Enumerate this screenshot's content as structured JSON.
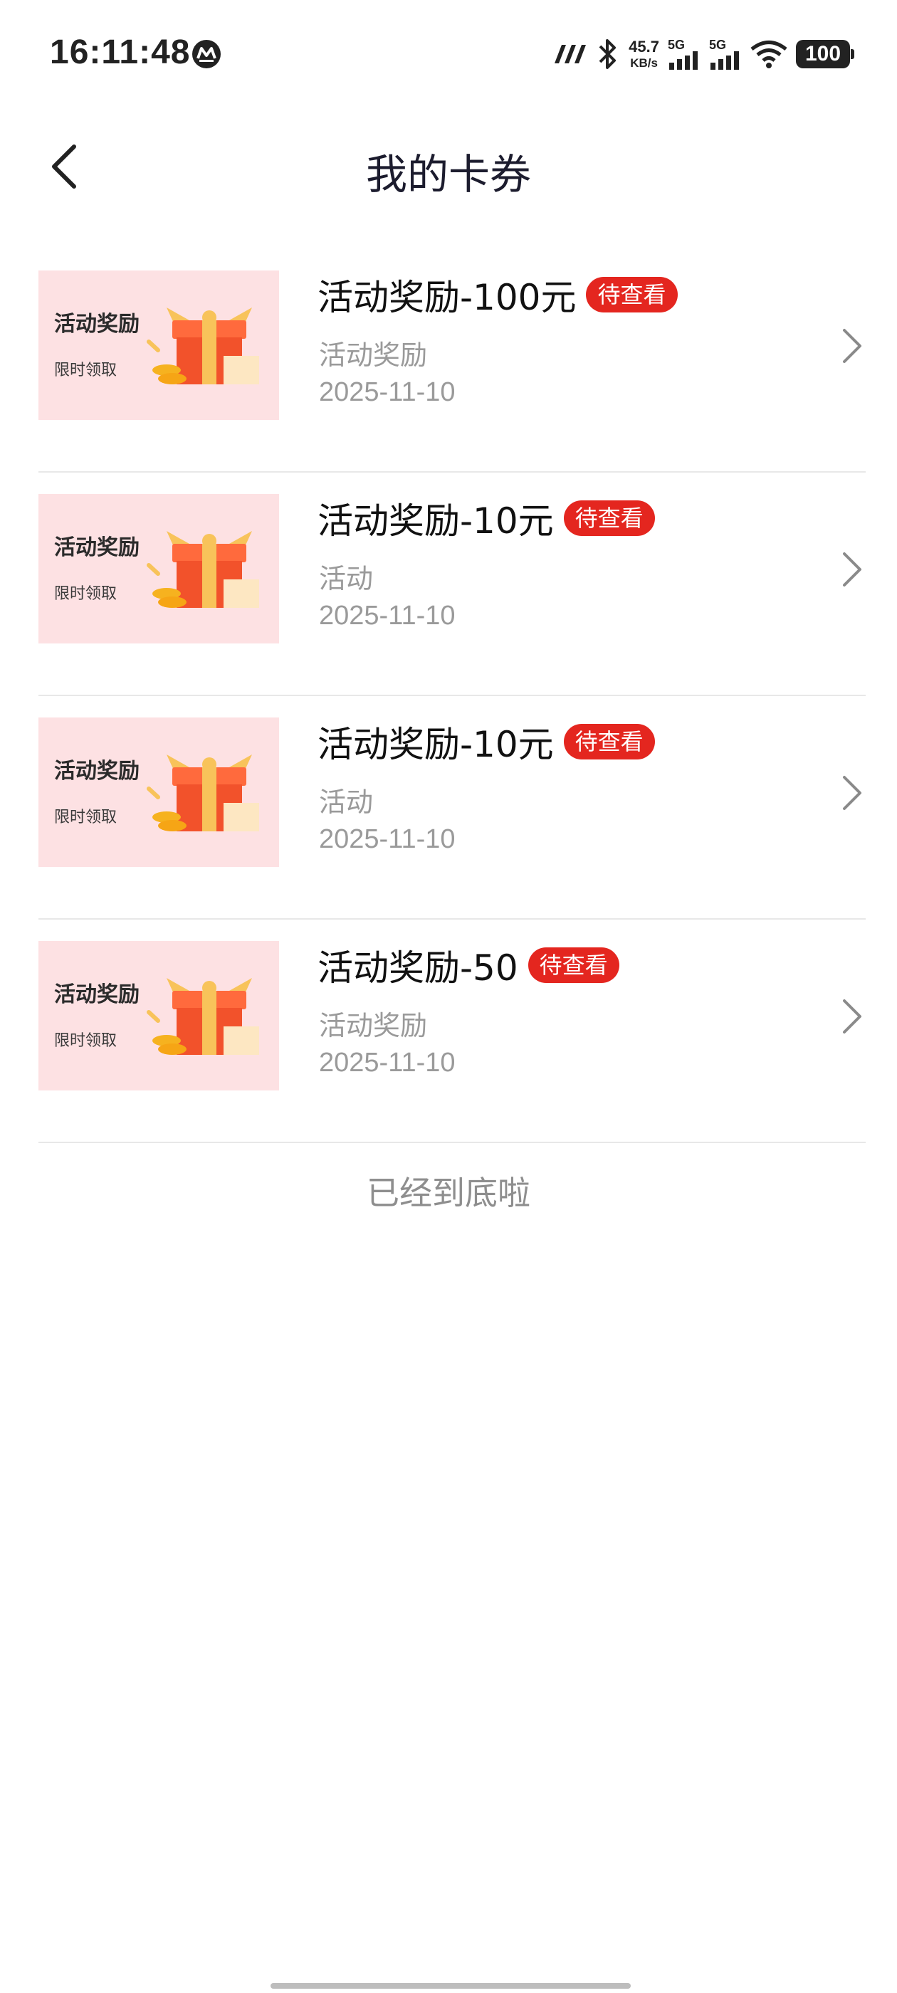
{
  "status_bar": {
    "time": "16:11:48",
    "net_speed_value": "45.7",
    "net_speed_unit": "KB/s",
    "signal_1_label": "5G",
    "signal_2_label": "5G",
    "battery_level": "100",
    "icons": [
      "carrier-logo-icon",
      "nfc-icon",
      "bluetooth-icon",
      "signal-icon",
      "wifi-icon",
      "battery-icon"
    ]
  },
  "header": {
    "title": "我的卡券"
  },
  "coupons": [
    {
      "thumb_title": "活动奖励",
      "thumb_sub": "限时领取",
      "title": "活动奖励-100元",
      "badge": "待查看",
      "subtitle": "活动奖励",
      "date": "2025-11-10"
    },
    {
      "thumb_title": "活动奖励",
      "thumb_sub": "限时领取",
      "title": "活动奖励-10元",
      "badge": "待查看",
      "subtitle": "活动",
      "date": "2025-11-10"
    },
    {
      "thumb_title": "活动奖励",
      "thumb_sub": "限时领取",
      "title": "活动奖励-10元",
      "badge": "待查看",
      "subtitle": "活动",
      "date": "2025-11-10"
    },
    {
      "thumb_title": "活动奖励",
      "thumb_sub": "限时领取",
      "title": "活动奖励-50",
      "badge": "待查看",
      "subtitle": "活动奖励",
      "date": "2025-11-10"
    }
  ],
  "footer": {
    "end_text": "已经到底啦"
  },
  "colors": {
    "badge_bg": "#e4261f",
    "thumb_bg": "#fde1e3",
    "muted_text": "#9a9a9a",
    "title_text": "#1c1c2e"
  }
}
